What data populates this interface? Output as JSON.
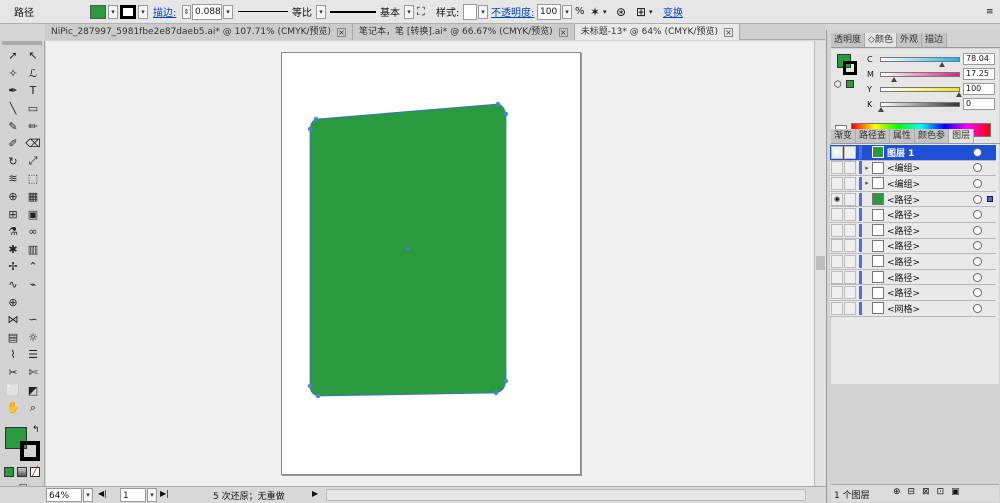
{
  "control_bar": {
    "object_type": "路径",
    "fill_color": "#2a9a3e",
    "stroke_label": "描边:",
    "stroke_weight": "0.088",
    "profile_label": "等比",
    "brush_label": "基本",
    "style_label": "样式:",
    "opacity_label": "不透明度:",
    "opacity_value": "100",
    "opacity_unit": "%",
    "transform_label": "变换"
  },
  "tabs": [
    {
      "label": "NiPic_287997_5981fbe2e87daeb5.ai* @ 107.71% (CMYK/预览)",
      "active": false
    },
    {
      "label": "笔记本，笔 [转换].ai* @ 66.67% (CMYK/预览)",
      "active": false
    },
    {
      "label": "未标题-13* @ 64% (CMYK/预览)",
      "active": true
    }
  ],
  "tools": [
    "selection-tool",
    "direct-selection-tool",
    "magic-wand-tool",
    "lasso-tool",
    "pen-tool",
    "type-tool",
    "line-tool",
    "rectangle-tool",
    "paintbrush-tool",
    "pencil-tool",
    "blob-brush-tool",
    "eraser-tool",
    "rotate-tool",
    "scale-tool",
    "warp-tool",
    "free-transform-tool",
    "shape-builder-tool",
    "perspective-grid-tool",
    "mesh-tool",
    "gradient-tool",
    "eyedropper-tool",
    "blend-tool",
    "symbol-sprayer-tool",
    "column-graph-tool",
    "pen-add-anchor-tool",
    "pen-convert-tool",
    "curvature-tool",
    "anchor-tool",
    "crosshair-tool",
    "",
    "width-tool",
    "wave-tool",
    "perspective-tool",
    "symbol-tool",
    "graph-tool",
    "list-tool",
    "knife-tool",
    "scissors-tool",
    "artboard-tool",
    "slice-tool",
    "hand-tool",
    "zoom-tool"
  ],
  "status_bar": {
    "zoom": "64%",
    "artboard_num": "1",
    "history": "5 次还原；无重做",
    "layer_count": "1 个图层"
  },
  "color_panel": {
    "tabs": [
      "透明度",
      "颜色",
      "外观",
      "描边"
    ],
    "active_tab": "颜色",
    "channels": [
      {
        "label": "C",
        "value": "78.04",
        "fraction": 0.7804
      },
      {
        "label": "M",
        "value": "17.25",
        "fraction": 0.1725
      },
      {
        "label": "Y",
        "value": "100",
        "fraction": 1.0
      },
      {
        "label": "K",
        "value": "0",
        "fraction": 0.0
      }
    ]
  },
  "layers_panel": {
    "tabs": [
      "渐变",
      "路径查",
      "属性",
      "颜色参",
      "图层"
    ],
    "active_tab": "图层",
    "rows": [
      {
        "name": "图层 1",
        "selected": true,
        "expander": "▾",
        "visible": true
      },
      {
        "name": "<编组>",
        "selected": false,
        "expander": "▸",
        "visible": false
      },
      {
        "name": "<编组>",
        "selected": false,
        "expander": "▸",
        "visible": false
      },
      {
        "name": "<路径>",
        "selected": false,
        "expander": "",
        "visible": true,
        "green": true
      },
      {
        "name": "<路径>",
        "selected": false,
        "expander": "",
        "visible": false
      },
      {
        "name": "<路径>",
        "selected": false,
        "expander": "",
        "visible": false
      },
      {
        "name": "<路径>",
        "selected": false,
        "expander": "",
        "visible": false
      },
      {
        "name": "<路径>",
        "selected": false,
        "expander": "",
        "visible": false
      },
      {
        "name": "<路径>",
        "selected": false,
        "expander": "",
        "visible": false
      },
      {
        "name": "<路径>",
        "selected": false,
        "expander": "",
        "visible": false
      },
      {
        "name": "<网格>",
        "selected": false,
        "expander": "",
        "visible": false
      }
    ]
  }
}
